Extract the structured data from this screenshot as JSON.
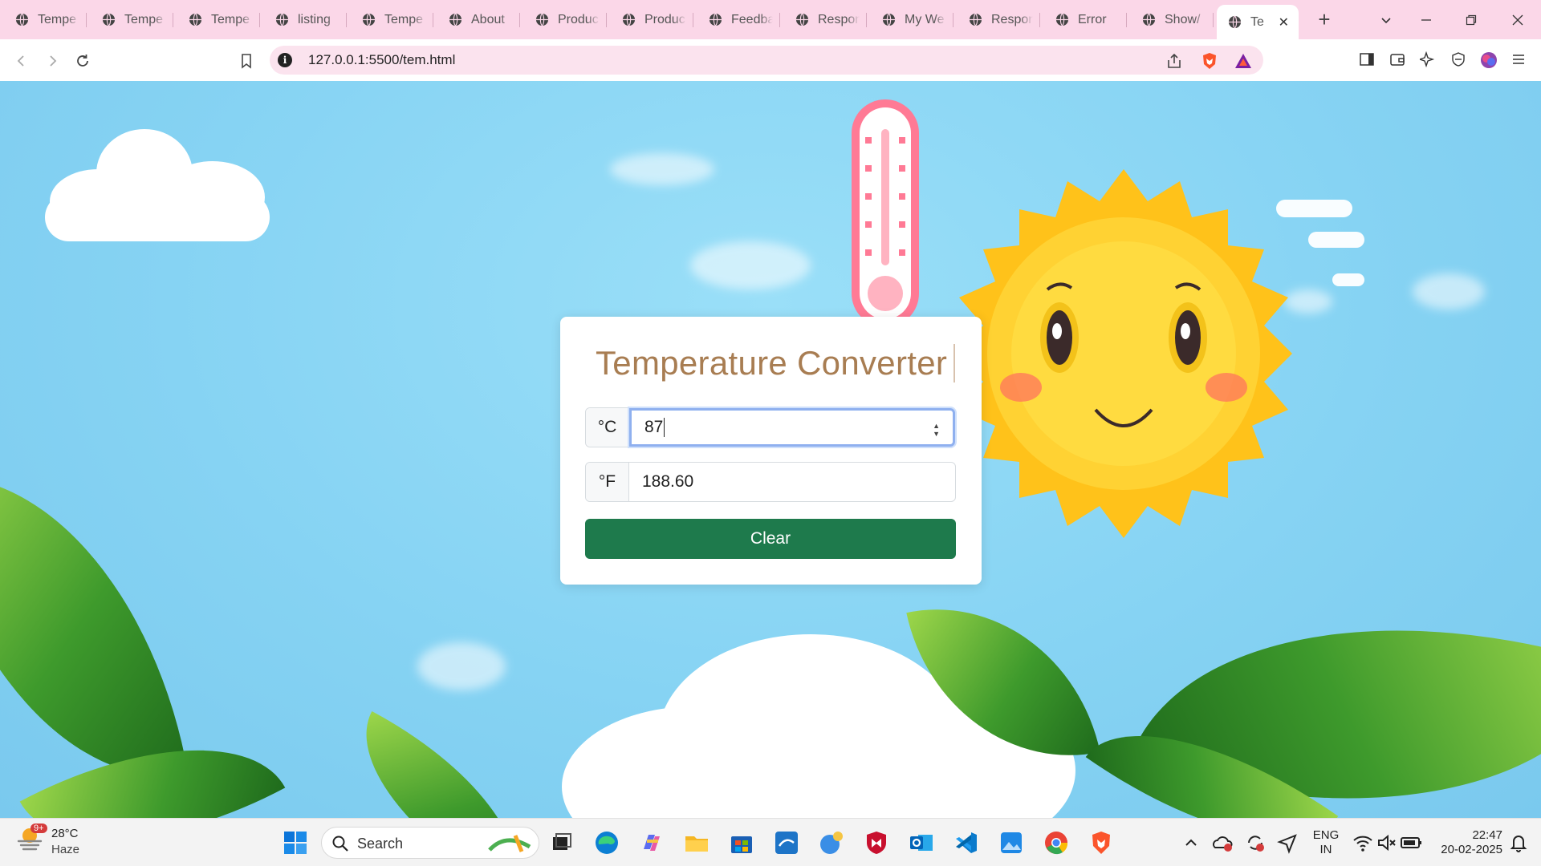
{
  "browser": {
    "tabs": [
      {
        "label": "Tempe",
        "active": false
      },
      {
        "label": "Tempe",
        "active": false
      },
      {
        "label": "Tempe",
        "active": false
      },
      {
        "label": "listing",
        "active": false
      },
      {
        "label": "Tempe",
        "active": false
      },
      {
        "label": "About",
        "active": false
      },
      {
        "label": "Produc",
        "active": false
      },
      {
        "label": "Produc",
        "active": false
      },
      {
        "label": "Feedba",
        "active": false
      },
      {
        "label": "Respon",
        "active": false
      },
      {
        "label": "My We",
        "active": false
      },
      {
        "label": "Respon",
        "active": false
      },
      {
        "label": "Error",
        "active": false
      },
      {
        "label": "Show/",
        "active": false
      },
      {
        "label": "Te",
        "active": true
      }
    ],
    "new_tab_symbol": "+",
    "close_symbol": "✕",
    "url": "127.0.0.1:5500/tem.html",
    "accent": "#fbd7e8"
  },
  "converter": {
    "title": "Temperature Converter",
    "celsius_unit": "°C",
    "celsius_value": "87",
    "fahrenheit_unit": "°F",
    "fahrenheit_value": "188.60",
    "clear_label": "Clear",
    "button_color": "#1e7a4c",
    "title_color": "#a87d52"
  },
  "taskbar": {
    "weather_temp": "28°C",
    "weather_desc": "Haze",
    "weather_badge": "9+",
    "search_label": "Search",
    "lang_top": "ENG",
    "lang_bottom": "IN",
    "time": "22:47",
    "date": "20-02-2025"
  }
}
